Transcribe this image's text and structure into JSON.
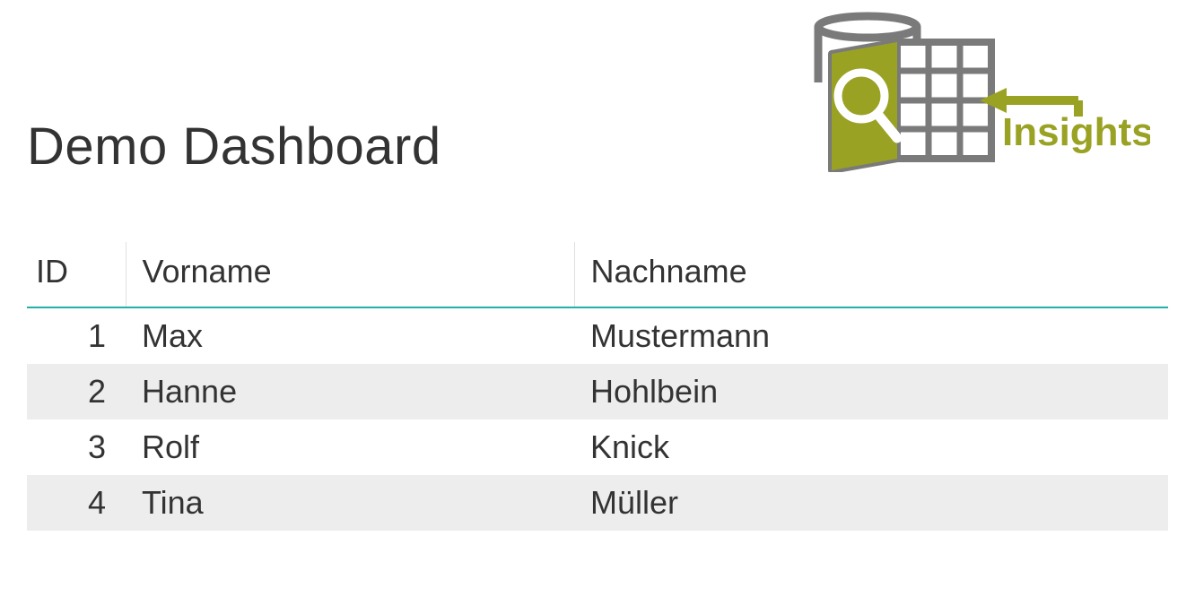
{
  "header": {
    "title": "Demo Dashboard",
    "logo_text": "Insights"
  },
  "table": {
    "columns": [
      "ID",
      "Vorname",
      "Nachname"
    ],
    "rows": [
      {
        "id": "1",
        "vorname": "Max",
        "nachname": "Mustermann"
      },
      {
        "id": "2",
        "vorname": "Hanne",
        "nachname": "Hohlbein"
      },
      {
        "id": "3",
        "vorname": "Rolf",
        "nachname": "Knick"
      },
      {
        "id": "4",
        "vorname": "Tina",
        "nachname": "Müller"
      }
    ]
  },
  "colors": {
    "accent": "#20b2aa",
    "logo_olive": "#99a023",
    "logo_gray": "#7a7a7a"
  }
}
